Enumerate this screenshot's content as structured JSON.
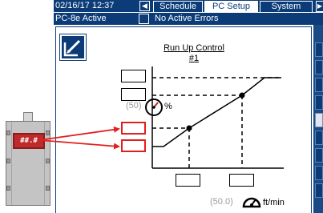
{
  "header": {
    "datetime": "02/16/17 12:37",
    "back_icon": "left-arrow-icon",
    "tabs": [
      {
        "label": "Schedule",
        "active": false
      },
      {
        "label": "PC Setup",
        "active": true
      },
      {
        "label": "System",
        "active": false
      }
    ],
    "more_icon": "right-arrow-icon"
  },
  "status": {
    "left": "PC-8e Active",
    "right": "No Active Errors"
  },
  "panel": {
    "edit_icon": "edit-icon",
    "title": "Run Up Control",
    "number": "#1",
    "percent_default": "(50)",
    "percent_unit": "%",
    "percent_icon": "gauge-icon",
    "speed_default": "(50.0)",
    "speed_unit": "ft/min",
    "speed_icon": "speedometer-icon"
  },
  "controller": {
    "display": "##.#",
    "display_color": "#bf2b2b"
  },
  "colors": {
    "header_bg": "#0b3c78",
    "highlight_red": "#e02020"
  }
}
